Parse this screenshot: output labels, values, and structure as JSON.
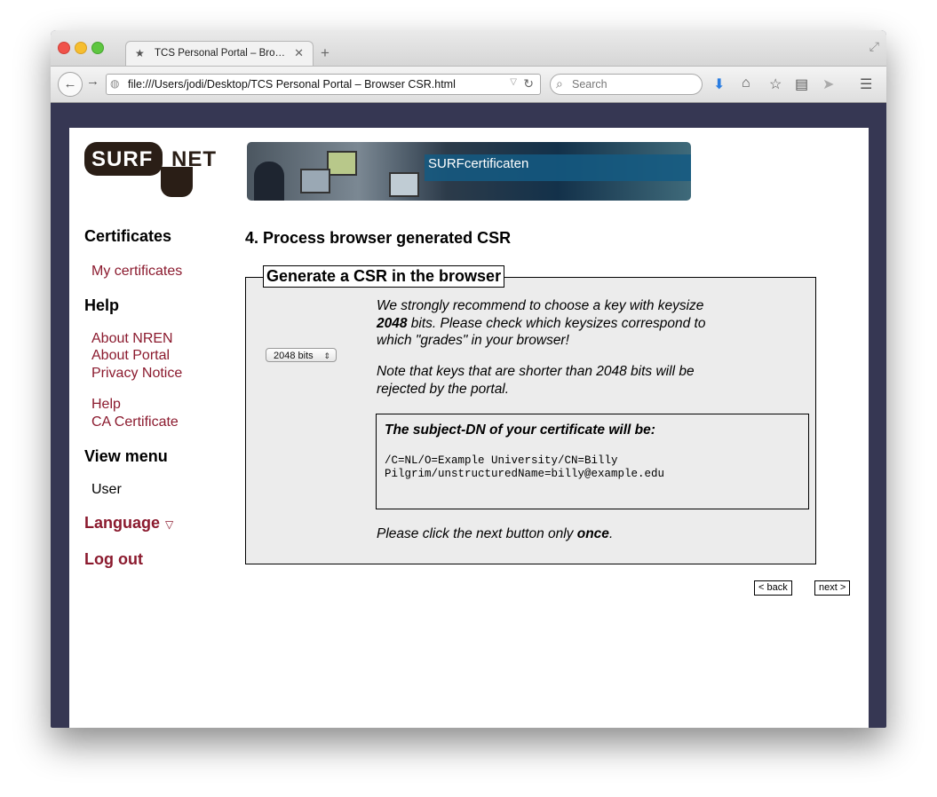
{
  "browser": {
    "tab_title": "TCS Personal Portal – Bro…",
    "url": "file:///Users/jodi/Desktop/TCS Personal Portal – Browser CSR.html",
    "search_placeholder": "Search"
  },
  "header": {
    "logo_text_left": "SURF",
    "logo_text_right": "NET",
    "banner_text": "SURFcertificaten"
  },
  "sidebar": {
    "certificates_heading": "Certificates",
    "my_certificates": "My certificates",
    "help_heading": "Help",
    "about_nren": "About NREN",
    "about_portal": "About Portal",
    "privacy_notice": "Privacy Notice",
    "help_link": "Help",
    "ca_certificate": "CA Certificate",
    "view_menu_heading": "View menu",
    "user_item": "User",
    "language": "Language",
    "log_out": "Log out"
  },
  "main": {
    "title": "4. Process browser generated CSR",
    "fieldset_legend": "Generate a CSR in the browser",
    "keysize_selected": "2048 bits",
    "recommend_part1": "We strongly recommend to choose a key with keysize ",
    "recommend_bold": "2048",
    "recommend_part2": " bits. Please check which keysizes correspond to which \"grades\" in your browser!",
    "note": "Note that keys that are shorter than 2048 bits will be rejected by the portal.",
    "dn_title": "The subject-DN of your certificate will be:",
    "dn_value": "/C=NL/O=Example University/CN=Billy Pilgrim/unstructuredName=billy@example.edu",
    "click_part1": "Please click the next button only ",
    "click_bold": "once",
    "click_part2": ".",
    "back_button": "< back",
    "next_button": "next >"
  },
  "colors": {
    "link": "#8b1a2e",
    "frame_background": "#363753",
    "fieldset_background": "#ececec"
  }
}
